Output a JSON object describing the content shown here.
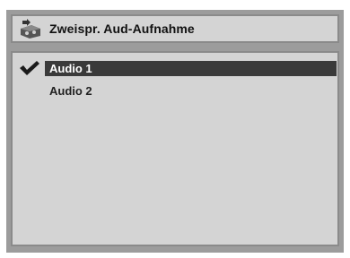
{
  "dialog": {
    "title": "Zweispr. Aud-Aufnahme",
    "title_icon": "audio-recording-icon",
    "items": [
      {
        "label": "Audio 1",
        "selected": true,
        "checked": true
      },
      {
        "label": "Audio 2",
        "selected": false,
        "checked": false
      }
    ]
  },
  "colors": {
    "frame": "#9c9c9c",
    "panel": "#d4d4d4",
    "selected_bar": "#3a3a3a",
    "selected_text": "#ffffff"
  }
}
